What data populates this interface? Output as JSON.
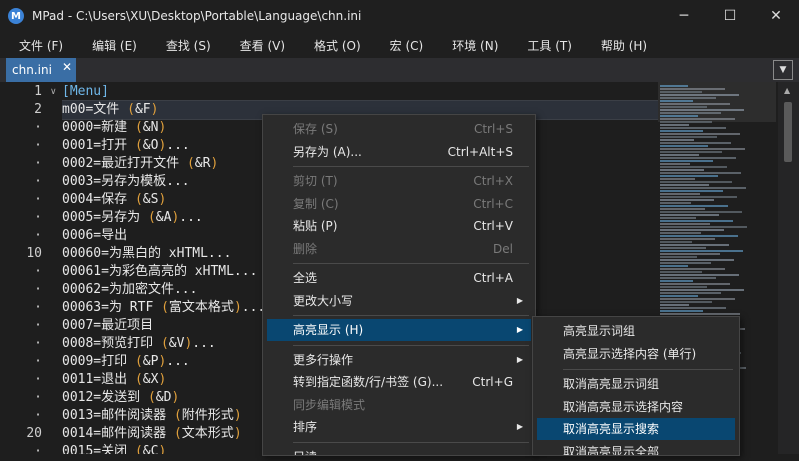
{
  "window": {
    "title": "MPad - C:\\Users\\XU\\Desktop\\Portable\\Language\\chn.ini",
    "app_icon": "M"
  },
  "controls": {
    "minimize": "─",
    "maximize": "☐",
    "close": "✕"
  },
  "menubar": [
    {
      "label": "文件 (F)"
    },
    {
      "label": "编辑 (E)"
    },
    {
      "label": "查找 (S)"
    },
    {
      "label": "查看 (V)"
    },
    {
      "label": "格式 (O)"
    },
    {
      "label": "宏 (C)"
    },
    {
      "label": "环境 (N)"
    },
    {
      "label": "工具 (T)"
    },
    {
      "label": "帮助 (H)"
    }
  ],
  "tabs": [
    {
      "label": "chn.ini",
      "close": "✕"
    }
  ],
  "tab_dropdown": "▼",
  "gutter": [
    {
      "num": "1",
      "fold": "∨"
    },
    {
      "num": "2"
    },
    {
      "num": "·"
    },
    {
      "num": "·"
    },
    {
      "num": "·"
    },
    {
      "num": "·"
    },
    {
      "num": "·"
    },
    {
      "num": "·"
    },
    {
      "num": "·"
    },
    {
      "num": "10"
    },
    {
      "num": "·"
    },
    {
      "num": "·"
    },
    {
      "num": "·"
    },
    {
      "num": "·"
    },
    {
      "num": "·"
    },
    {
      "num": "·"
    },
    {
      "num": "·"
    },
    {
      "num": "·"
    },
    {
      "num": "·"
    },
    {
      "num": "20"
    },
    {
      "num": "·"
    }
  ],
  "code_lines": [
    "[Menu]",
    "m00=文件 (&F)",
    "0000=新建 (&N)",
    "0001=打开 (&O)...",
    "0002=最近打开文件 (&R)",
    "0003=另存为模板...",
    "0004=保存 (&S)",
    "0005=另存为 (&A)...",
    "0006=导出",
    "00060=为黑白的 xHTML...",
    "00061=为彩色高亮的 xHTML...",
    "00062=为加密文件...",
    "00063=为 RTF (富文本格式)...",
    "0007=最近项目",
    "0008=预览打印 (&V)...",
    "0009=打印 (&P)...",
    "0011=退出 (&X)",
    "0012=发送到 (&D)",
    "0013=邮件阅读器 (附件形式)",
    "0014=邮件阅读器 (文本形式)",
    "0015=关闭 (&C)"
  ],
  "context_menu": [
    {
      "label": "保存 (S)",
      "shortcut": "Ctrl+S",
      "state": "disabled"
    },
    {
      "label": "另存为 (A)...",
      "shortcut": "Ctrl+Alt+S",
      "state": "enabled"
    },
    {
      "sep": true
    },
    {
      "label": "剪切 (T)",
      "shortcut": "Ctrl+X",
      "state": "disabled"
    },
    {
      "label": "复制 (C)",
      "shortcut": "Ctrl+C",
      "state": "disabled"
    },
    {
      "label": "粘贴 (P)",
      "shortcut": "Ctrl+V",
      "state": "enabled"
    },
    {
      "label": "删除",
      "shortcut": "Del",
      "state": "disabled"
    },
    {
      "sep": true
    },
    {
      "label": "全选",
      "shortcut": "Ctrl+A",
      "state": "enabled"
    },
    {
      "label": "更改大小写",
      "arrow": "▶",
      "state": "enabled"
    },
    {
      "sep": true
    },
    {
      "label": "高亮显示 (H)",
      "arrow": "▶",
      "state": "active"
    },
    {
      "sep": true
    },
    {
      "label": "更多行操作",
      "arrow": "▶",
      "state": "enabled"
    },
    {
      "label": "转到指定函数/行/书签 (G)...",
      "shortcut": "Ctrl+G",
      "state": "enabled"
    },
    {
      "label": "同步编辑模式",
      "state": "disabled"
    },
    {
      "label": "排序",
      "arrow": "▶",
      "state": "enabled"
    },
    {
      "sep": true
    },
    {
      "label": "只读",
      "state": "enabled"
    }
  ],
  "submenu": [
    {
      "label": "高亮显示词组"
    },
    {
      "label": "高亮显示选择内容 (单行)"
    },
    {
      "sep": true
    },
    {
      "label": "取消高亮显示词组"
    },
    {
      "label": "取消高亮显示选择内容"
    },
    {
      "label": "取消高亮显示搜索",
      "active": true
    },
    {
      "label": "取消高亮显示全部"
    }
  ],
  "colors": {
    "accent": "#094771",
    "tab": "#3a6ea5",
    "bracket": "#e0a03c",
    "section": "#6fb7e9",
    "key": "#e8e8e8"
  }
}
